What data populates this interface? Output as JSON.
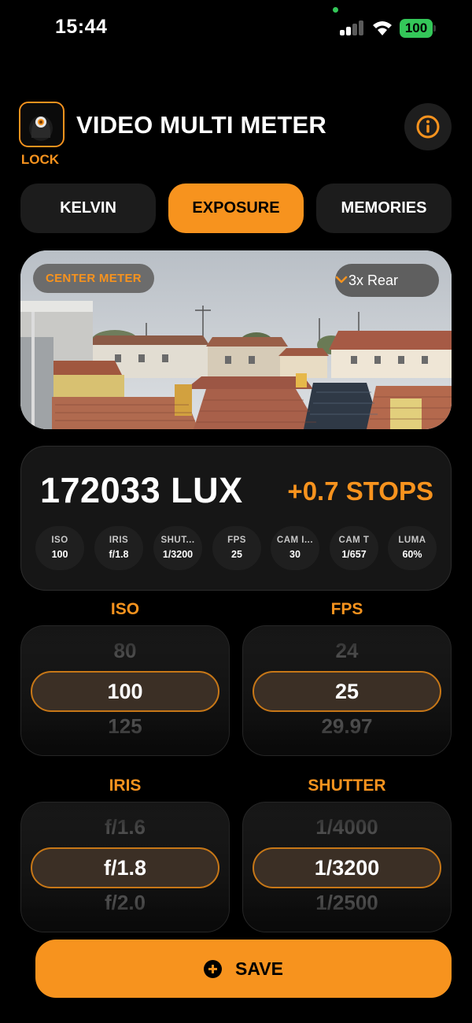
{
  "status_bar": {
    "time": "15:44",
    "battery": "100"
  },
  "header": {
    "title": "VIDEO MULTI METER",
    "lock_label": "LOCK"
  },
  "tabs": [
    {
      "label": "KELVIN",
      "active": false
    },
    {
      "label": "EXPOSURE",
      "active": true
    },
    {
      "label": "MEMORIES",
      "active": false
    }
  ],
  "preview": {
    "meter_mode": "CENTER METER",
    "lens": "3x Rear"
  },
  "reading": {
    "lux": "172033 LUX",
    "stops": "+0.7 STOPS",
    "metrics": [
      {
        "label": "ISO",
        "value": "100"
      },
      {
        "label": "IRIS",
        "value": "f/1.8"
      },
      {
        "label": "SHUT...",
        "value": "1/3200"
      },
      {
        "label": "FPS",
        "value": "25"
      },
      {
        "label": "CAM I...",
        "value": "30"
      },
      {
        "label": "CAM T",
        "value": "1/657"
      },
      {
        "label": "LUMA",
        "value": "60%"
      }
    ]
  },
  "pickers": {
    "iso": {
      "label": "ISO",
      "prev": "80",
      "selected": "100",
      "next": "125"
    },
    "fps": {
      "label": "FPS",
      "prev": "24",
      "selected": "25",
      "next": "29.97"
    },
    "iris": {
      "label": "IRIS",
      "prev": "f/1.6",
      "selected": "f/1.8",
      "next": "f/2.0"
    },
    "shutter": {
      "label": "SHUTTER",
      "prev": "1/4000",
      "selected": "1/3200",
      "next": "1/2500"
    }
  },
  "save_label": "SAVE",
  "colors": {
    "accent": "#f7931e",
    "background": "#000000",
    "card": "#161616",
    "battery": "#34c759"
  },
  "icons": [
    "signal-icon",
    "wifi-icon",
    "battery-icon",
    "lock-app-icon",
    "info-icon",
    "chevron-down-icon",
    "plus-circle-icon"
  ]
}
